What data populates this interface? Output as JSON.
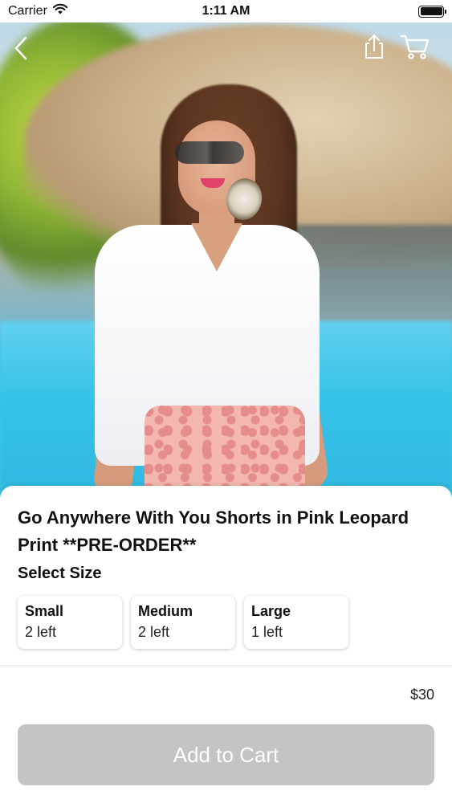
{
  "status_bar": {
    "carrier": "Carrier",
    "time": "1:11 AM",
    "icons": [
      "wifi-icon",
      "battery-icon"
    ]
  },
  "nav": {
    "back_icon": "chevron-left-icon",
    "share_icon": "share-icon",
    "cart_icon": "cart-icon"
  },
  "product": {
    "image": "product-photo",
    "title": "Go Anywhere With You Shorts in Pink Leopard Print **PRE-ORDER**",
    "select_size_label": "Select Size",
    "sizes": [
      {
        "name": "Small",
        "stock": "2 left"
      },
      {
        "name": "Medium",
        "stock": "2 left"
      },
      {
        "name": "Large",
        "stock": "1 left"
      }
    ],
    "price": "$30"
  },
  "actions": {
    "add_to_cart_label": "Add to Cart"
  },
  "colors": {
    "disabled_button": "#c4c4c6",
    "text": "#111111",
    "background": "#ffffff"
  }
}
